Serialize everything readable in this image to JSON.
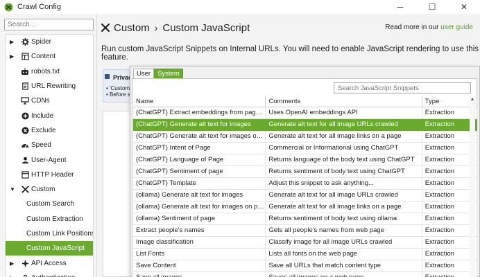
{
  "window": {
    "title": "Crawl Config",
    "minimize": "─",
    "maximize": "☐",
    "close": "✕"
  },
  "sidebar": {
    "search_placeholder": "Search...",
    "items": [
      {
        "label": "Spider",
        "arrow": "▶",
        "icon": "gear-icon"
      },
      {
        "label": "Content",
        "arrow": "▶",
        "icon": "content-icon"
      },
      {
        "label": "robots.txt",
        "arrow": "",
        "icon": "robot-icon"
      },
      {
        "label": "URL Rewriting",
        "arrow": "",
        "icon": "rewrite-icon"
      },
      {
        "label": "CDNs",
        "arrow": "",
        "icon": "cdn-icon"
      },
      {
        "label": "Include",
        "arrow": "",
        "icon": "include-icon"
      },
      {
        "label": "Exclude",
        "arrow": "",
        "icon": "exclude-icon"
      },
      {
        "label": "Speed",
        "arrow": "",
        "icon": "speed-icon"
      },
      {
        "label": "User-Agent",
        "arrow": "",
        "icon": "user-agent-icon"
      },
      {
        "label": "HTTP Header",
        "arrow": "",
        "icon": "http-header-icon"
      },
      {
        "label": "Custom",
        "arrow": "▼",
        "icon": "tools-icon"
      },
      {
        "label": "Custom Search",
        "child": true
      },
      {
        "label": "Custom Extraction",
        "child": true
      },
      {
        "label": "Custom Link Positions",
        "child": true
      },
      {
        "label": "Custom JavaScript",
        "child": true,
        "selected": true
      },
      {
        "label": "API Access",
        "arrow": "▶",
        "icon": "api-icon"
      },
      {
        "label": "Authentication",
        "arrow": "▶",
        "icon": "auth-icon"
      }
    ]
  },
  "header": {
    "crumb1": "Custom",
    "sep": "›",
    "crumb2": "Custom JavaScript",
    "read_more_prefix": "Read more in our",
    "read_more_link": "user guide"
  },
  "description": "Run custom JavaScript Snippets on Internal URLs. You will need to enable JavaScript rendering to use this feature.",
  "privacy": {
    "title": "Privac",
    "line1": "• 'Custom",
    "line2": "• Before s"
  },
  "popup": {
    "tabs": [
      "User",
      "System"
    ],
    "active_tab": "System",
    "search_placeholder": "Search JavaScript Snippets",
    "columns": [
      "Name",
      "Comments",
      "Type"
    ],
    "rows": [
      [
        "(ChatGPT) Extract embeddings from page con...",
        "Uses OpenAI embeddings API",
        "Extraction"
      ],
      [
        "(ChatGPT) Generate alt text for images",
        "Generate alt text for all image URLs crawled",
        "Extraction"
      ],
      [
        "(ChatGPT) Generate alt text for images on page",
        "Generate alt text for all image links on a page",
        "Extraction"
      ],
      [
        "(ChatGPT) Intent of Page",
        "Commercial or Informational using ChatGPT",
        "Extraction"
      ],
      [
        "(ChatGPT) Language of Page",
        "Returns language of the body text using ChatGPT",
        "Extraction"
      ],
      [
        "(ChatGPT) Sentiment of page",
        "Returns sentiment of body text using ChatGPT",
        "Extraction"
      ],
      [
        "(ChatGPT) Template",
        "Adjust this snippet to ask anything...",
        "Extraction"
      ],
      [
        "(ollama) Generate alt text for images",
        "Generate alt text for all image URLs crawled",
        "Extraction"
      ],
      [
        "(ollama) Generate alt text for images on page",
        "Generate alt text for all image links on a page",
        "Extraction"
      ],
      [
        "(ollama) Sentiment of page",
        "Returns sentiment of body text using ollama",
        "Extraction"
      ],
      [
        "Extract people's names",
        "Gets all people's names from web page",
        "Extraction"
      ],
      [
        "Image classification",
        "Classify image for all image URLs crawled",
        "Extraction"
      ],
      [
        "List Fonts",
        "Lists all fonts on the web page",
        "Extraction"
      ],
      [
        "Save Content",
        "Save all URLs that match content type",
        "Extraction"
      ],
      [
        "Save all images",
        "Saves all images on a web page",
        "Extraction"
      ]
    ],
    "selected_row": 1
  },
  "colors": {
    "accent": "#6aab2f",
    "link": "#5a9e2a"
  }
}
